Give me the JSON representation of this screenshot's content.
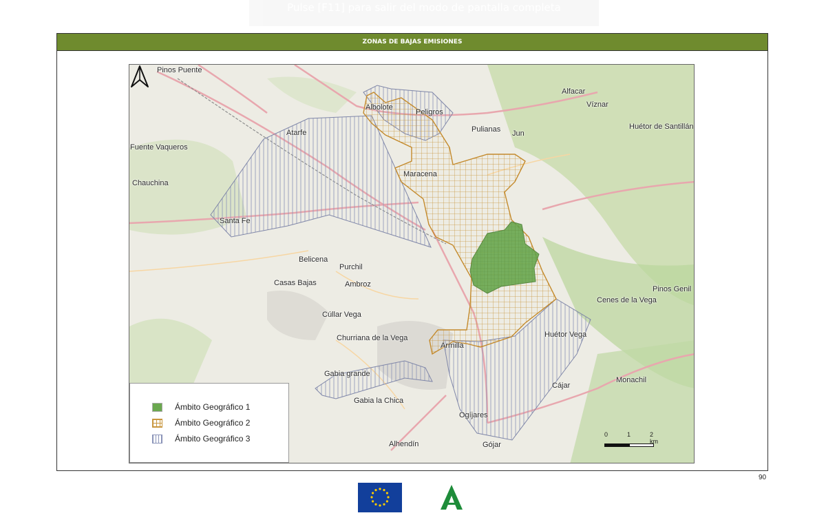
{
  "fullscreen_hint": "Pulse [F11] para salir del modo de pantalla completa",
  "header_title": "ZONAS DE BAJAS EMISIONES",
  "places": [
    {
      "name": "Pinos Puente",
      "id": "pinos-puente"
    },
    {
      "name": "Albolote",
      "id": "albolote"
    },
    {
      "name": "Peligros",
      "id": "peligros"
    },
    {
      "name": "Alfacar",
      "id": "alfacar"
    },
    {
      "name": "Víznar",
      "id": "viznar"
    },
    {
      "name": "Atarfe",
      "id": "atarfe"
    },
    {
      "name": "Pulianas",
      "id": "pulianas"
    },
    {
      "name": "Jun",
      "id": "jun"
    },
    {
      "name": "Huétor de Santillán",
      "id": "huetor-santillan"
    },
    {
      "name": "Fuente Vaqueros",
      "id": "fuente-vaqueros"
    },
    {
      "name": "Maracena",
      "id": "maracena"
    },
    {
      "name": "Chauchina",
      "id": "chauchina"
    },
    {
      "name": "Santa Fe",
      "id": "santa-fe"
    },
    {
      "name": "Belicena",
      "id": "belicena"
    },
    {
      "name": "Purchil",
      "id": "purchil"
    },
    {
      "name": "Casas Bajas",
      "id": "casas-bajas"
    },
    {
      "name": "Ambroz",
      "id": "ambroz"
    },
    {
      "name": "Pinos Genil",
      "id": "pinos-genil"
    },
    {
      "name": "Cenes de la Vega",
      "id": "cenes-vega"
    },
    {
      "name": "Cúllar Vega",
      "id": "cullar-vega"
    },
    {
      "name": "Churriana de la Vega",
      "id": "churriana-vega"
    },
    {
      "name": "Armilla",
      "id": "armilla"
    },
    {
      "name": "Huétor Vega",
      "id": "huetor-vega"
    },
    {
      "name": "Gabia grande",
      "id": "gabia-grande"
    },
    {
      "name": "Cájar",
      "id": "cajar"
    },
    {
      "name": "Monachil",
      "id": "monachil"
    },
    {
      "name": "Gabia la Chica",
      "id": "gabia-chica"
    },
    {
      "name": "Ogíjares",
      "id": "ogijares"
    },
    {
      "name": "Alhendín",
      "id": "alhendin"
    },
    {
      "name": "Gójar",
      "id": "gojar"
    }
  ],
  "legend": [
    {
      "label": "Ámbito Geográfico 1",
      "color": "#6aa84f"
    },
    {
      "label": "Ámbito Geográfico 2",
      "color": "#c8963e"
    },
    {
      "label": "Ámbito Geográfico 3",
      "color": "#8a93b8"
    }
  ],
  "scale": {
    "labels": [
      "0",
      "1",
      "2 km"
    ]
  },
  "page_number": "90",
  "colors": {
    "header_bg": "#6f8b2e",
    "zone1": "#6aa84f",
    "zone2": "#c8963e",
    "zone3": "#8a93b8",
    "eu_blue": "#123f9b",
    "eu_star": "#ffcc00",
    "junta_green": "#1e8c3a"
  },
  "icons": {
    "north": "north-arrow-icon",
    "eu": "eu-flag-icon",
    "junta": "junta-andalucia-logo"
  }
}
